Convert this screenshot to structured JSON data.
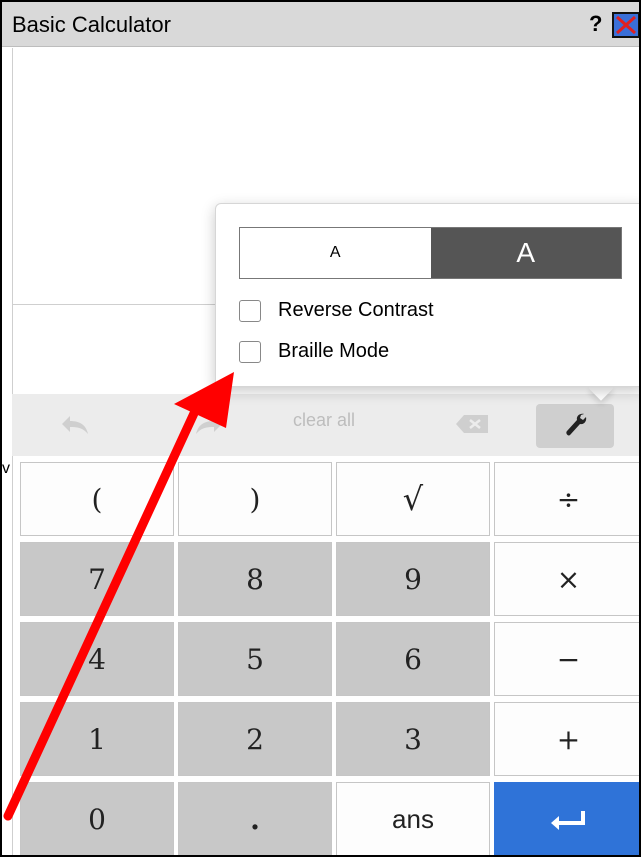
{
  "window": {
    "title": "Basic Calculator",
    "help_label": "?",
    "close_icon": "close-icon"
  },
  "stray_text": "v",
  "toolbar": {
    "undo_icon": "undo-icon",
    "redo_icon": "redo-icon",
    "clear_label": "clear all",
    "backspace_icon": "backspace-icon",
    "settings_icon": "wrench-icon"
  },
  "settings_popup": {
    "text_size_small": "A",
    "text_size_large": "A",
    "text_size_selected": "large",
    "reverse_contrast_label": "Reverse Contrast",
    "reverse_contrast_checked": false,
    "braille_mode_label": "Braille Mode",
    "braille_mode_checked": false
  },
  "keypad": {
    "rows": [
      [
        "(",
        ")",
        "√",
        "÷"
      ],
      [
        "7",
        "8",
        "9",
        "×"
      ],
      [
        "4",
        "5",
        "6",
        "−"
      ],
      [
        "1",
        "2",
        "3",
        "+"
      ],
      [
        "0",
        ".",
        "ans",
        "enter"
      ]
    ],
    "enter_icon": "enter-icon"
  },
  "colors": {
    "title_bar": "#d9d9d9",
    "digit_key": "#c8c8c8",
    "operator_key": "#fdfdfd",
    "enter_key": "#2f73d8",
    "selected_size": "#555555",
    "annotation_arrow": "#ff0000"
  }
}
